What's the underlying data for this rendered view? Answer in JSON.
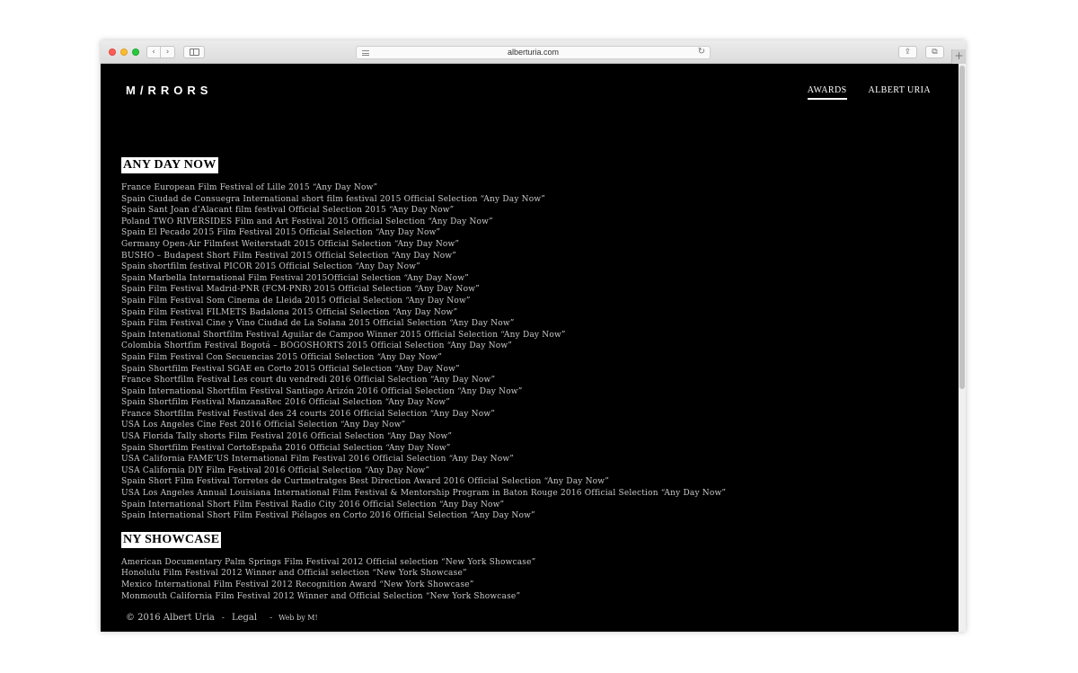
{
  "browser": {
    "url": "alberturia.com",
    "back_icon": "‹",
    "forward_icon": "›",
    "share_icon": "⇪",
    "tabs_icon": "⧉",
    "reload_icon": "↻",
    "new_tab_icon": "+"
  },
  "site": {
    "logo": "M/RRORS",
    "nav": [
      {
        "label": "AWARDS",
        "active": true
      },
      {
        "label": "ALBERT URIA",
        "active": false
      }
    ]
  },
  "sections": [
    {
      "title": "ANY DAY NOW",
      "items": [
        "France European Film Festival of Lille 2015 “Any Day Now”",
        "Spain Ciudad de Consuegra International short film festival 2015 Official Selection “Any Day Now”",
        "Spain Sant Joan d’Alacant film festival Official Selection 2015 “Any Day Now”",
        "Poland TWO RIVERSIDES Film and Art Festival 2015 Official Selection “Any Day Now”",
        "Spain El Pecado 2015 Film Festival 2015 Official Selection “Any Day Now”",
        "Germany Open-Air Filmfest Weiterstadt 2015 Official Selection “Any Day Now”",
        "BUSHO – Budapest Short Film Festival 2015 Official Selection “Any Day Now”",
        "Spain shortfilm festival PICOR 2015 Official Selection “Any Day Now”",
        "Spain Marbella International Film Festival 2015Official Selection “Any Day Now”",
        "Spain Film Festival  Madrid-PNR (FCM-PNR) 2015 Official Selection “Any Day Now”",
        "Spain Film Festival Som Cinema de Lleida 2015 Official Selection “Any Day Now”",
        "Spain Film Festival FILMETS Badalona 2015 Official Selection “Any Day Now”",
        "Spain Film Festival Cine y Vino Ciudad de La Solana 2015 Official Selection “Any Day Now”",
        "Spain Intenational Shortfilm Festival Aguilar de Campoo Winner 2015 Official Selection “Any Day Now”",
        "Colombia Shortfim Festival Bogotá – BOGOSHORTS 2015 Official Selection “Any Day Now”",
        "Spain Film Festival Con Secuencias 2015 Official Selection “Any Day Now”",
        "Spain Shortfilm Festival SGAE en Corto 2015 Official Selection “Any Day Now”",
        "France Shortfilm Festival Les court du vendredi 2016 Official Selection “Any Day Now”",
        "Spain International Shortfilm Festival Santiago Arizón 2016 Official Selection “Any Day Now”",
        "Spain Shortfilm Festival ManzanaRec 2016 Official Selection “Any Day Now”",
        "France Shortfilm Festival Festival des 24 courts 2016 Official Selection “Any Day Now”",
        "USA Los Angeles Cine Fest 2016 Official Selection “Any Day Now”",
        "USA Florida Tally shorts Film Festival 2016 Official Selection “Any Day Now”",
        "Spain Shortfilm Festival CortoEspaña 2016 Official Selection “Any Day Now”",
        "USA California FAME’US International Film Festival 2016 Official Selection “Any Day Now”",
        "USA California DIY Film Festival 2016 Official Selection “Any Day Now”",
        "Spain Short Film Festival Torretes de Curtmetratges Best Direction Award 2016 Official Selection “Any Day Now”",
        "USA Los Angeles Annual Louisiana International Film Festival & Mentorship Program in Baton Rouge 2016 Official Selection “Any Day Now”",
        "Spain International Short Film Festival Radio City 2016 Official Selection “Any Day Now”",
        "Spain International Short Film Festival Piélagos en Corto 2016 Official Selection “Any Day Now”"
      ]
    },
    {
      "title": "NY SHOWCASE",
      "items": [
        "American Documentary Palm Springs Film Festival 2012 Official selection “New York Showcase”",
        "Honolulu Film Festival 2012 Winner and Official selection “New York Showcase”",
        "Mexico International Film Festival 2012 Recognition Award “New York Showcase”",
        "Monmouth California Film Festival 2012 Winner and Official Selection “New York Showcase”"
      ]
    }
  ],
  "footer": {
    "copyright": "© 2016 Albert Uria",
    "separator": "-",
    "legal": "Legal",
    "web_by": "Web by M!"
  }
}
